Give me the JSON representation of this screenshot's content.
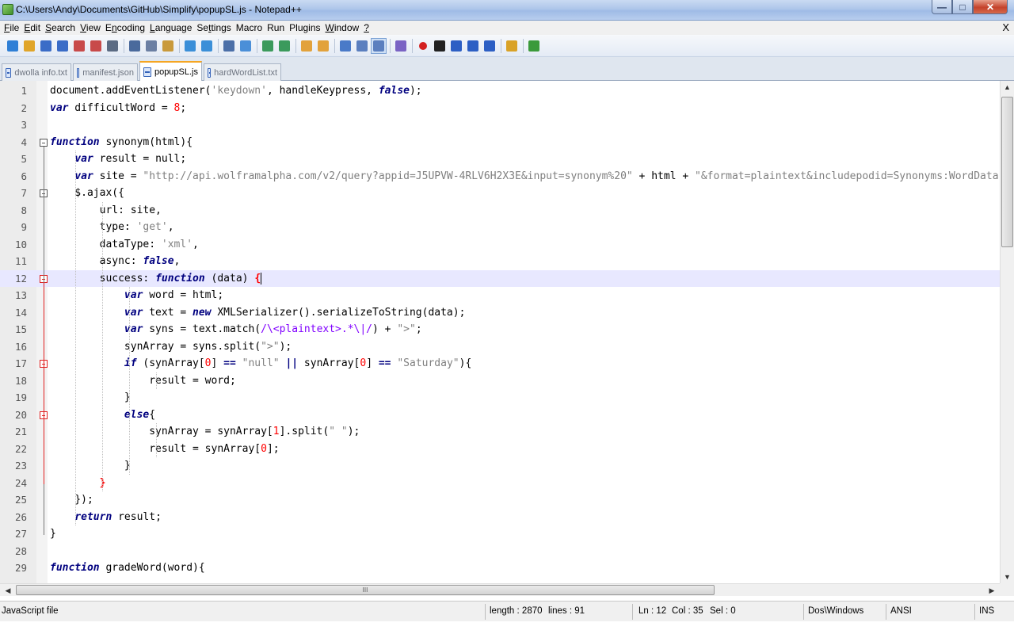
{
  "window": {
    "title": "C:\\Users\\Andy\\Documents\\GitHub\\Simplify\\popupSL.js - Notepad++"
  },
  "menu": {
    "items": [
      {
        "pre": "",
        "key": "F",
        "post": "ile"
      },
      {
        "pre": "",
        "key": "E",
        "post": "dit"
      },
      {
        "pre": "",
        "key": "S",
        "post": "earch"
      },
      {
        "pre": "",
        "key": "V",
        "post": "iew"
      },
      {
        "pre": "E",
        "key": "n",
        "post": "coding"
      },
      {
        "pre": "",
        "key": "L",
        "post": "anguage"
      },
      {
        "pre": "Se",
        "key": "t",
        "post": "tings"
      },
      {
        "pre": "Macro",
        "key": "",
        "post": ""
      },
      {
        "pre": "Run",
        "key": "",
        "post": ""
      },
      {
        "pre": "Plugins",
        "key": "",
        "post": ""
      },
      {
        "pre": "",
        "key": "W",
        "post": "indow"
      },
      {
        "pre": "",
        "key": "?",
        "post": ""
      }
    ],
    "close": "X"
  },
  "tabs": [
    {
      "label": "dwolla info.txt",
      "active": false
    },
    {
      "label": "manifest.json",
      "active": false
    },
    {
      "label": "popupSL.js",
      "active": true
    },
    {
      "label": "hardWordList.txt",
      "active": false
    }
  ],
  "editor": {
    "current_line": 12,
    "lines": [
      {
        "n": "1",
        "html": "document.addEventListener(<span class=\"str\">'keydown'</span>, handleKeypress, <span class=\"kw\">false</span>);"
      },
      {
        "n": "2",
        "html": "<span class=\"kw\">var</span> difficultWord = <span class=\"num\">8</span>;"
      },
      {
        "n": "3",
        "html": ""
      },
      {
        "n": "4",
        "html": "<span class=\"kw\">function</span> synonym(html){"
      },
      {
        "n": "5",
        "html": "    <span class=\"kw\">var</span> result = null;"
      },
      {
        "n": "6",
        "html": "    <span class=\"kw\">var</span> site = <span class=\"str\">\"http://api.wolframalpha.com/v2/query?appid=J5UPVW-4RLV6H2X3E&input=synonym%20\"</span> + html + <span class=\"str\">\"&format=plaintext&includepodid=Synonyms:WordData\"</span>;"
      },
      {
        "n": "7",
        "html": "    $.ajax({"
      },
      {
        "n": "8",
        "html": "        url: site,"
      },
      {
        "n": "9",
        "html": "        type: <span class=\"str\">'get'</span>,"
      },
      {
        "n": "10",
        "html": "        dataType: <span class=\"str\">'xml'</span>,"
      },
      {
        "n": "11",
        "html": "        async: <span class=\"kw\">false</span>,"
      },
      {
        "n": "12",
        "html": "        success: <span class=\"kw\">function</span> (data) <span class=\"brace-hl\">{</span>"
      },
      {
        "n": "13",
        "html": "            <span class=\"kw\">var</span> word = html;"
      },
      {
        "n": "14",
        "html": "            <span class=\"kw\">var</span> text = <span class=\"kw\">new</span> XMLSerializer().serializeToString(data);"
      },
      {
        "n": "15",
        "html": "            <span class=\"kw\">var</span> syns = text.match(<span class=\"rx\">/\\&lt;plaintext&gt;.*\\|/</span>) + <span class=\"str\">\"&gt;\"</span>;"
      },
      {
        "n": "16",
        "html": "            synArray = syns.split(<span class=\"str\">\"&gt;\"</span>);"
      },
      {
        "n": "17",
        "html": "            <span class=\"kw\">if</span> (synArray[<span class=\"num\">0</span>] <span class=\"op\">==</span> <span class=\"str\">\"null\"</span> <span class=\"op\">||</span> synArray[<span class=\"num\">0</span>] <span class=\"op\">==</span> <span class=\"str\">\"Saturday\"</span>){"
      },
      {
        "n": "18",
        "html": "                result = word;"
      },
      {
        "n": "19",
        "html": "            }"
      },
      {
        "n": "20",
        "html": "            <span class=\"kw\">else</span>{"
      },
      {
        "n": "21",
        "html": "                synArray = synArray[<span class=\"num\">1</span>].split(<span class=\"str\">\" \"</span>);"
      },
      {
        "n": "22",
        "html": "                result = synArray[<span class=\"num\">0</span>];"
      },
      {
        "n": "23",
        "html": "            }"
      },
      {
        "n": "24",
        "html": "        <span class=\"num\" style=\"font-weight:bold\">}</span>"
      },
      {
        "n": "25",
        "html": "    });"
      },
      {
        "n": "26",
        "html": "    <span class=\"kw\">return</span> result;"
      },
      {
        "n": "27",
        "html": "}"
      },
      {
        "n": "28",
        "html": ""
      },
      {
        "n": "29",
        "html": "<span class=\"kw\">function</span> gradeWord(word){"
      }
    ]
  },
  "statusbar": {
    "file_type": "JavaScript file",
    "length": "length : 2870",
    "lines": "lines : 91",
    "ln": "Ln : 12",
    "col": "Col : 35",
    "sel": "Sel : 0",
    "eol": "Dos\\Windows",
    "encoding": "ANSI",
    "mode": "INS"
  },
  "scroll": {
    "thumb_label": "III"
  },
  "icons": {
    "toolbar": [
      "new-file-icon",
      "open-file-icon",
      "save-icon",
      "save-all-icon",
      "close-icon",
      "close-all-icon",
      "print-icon",
      "cut-icon",
      "copy-icon",
      "paste-icon",
      "undo-icon",
      "redo-icon",
      "find-icon",
      "replace-icon",
      "zoom-in-icon",
      "zoom-out-icon",
      "sync-vertical-icon",
      "sync-horizontal-icon",
      "word-wrap-icon",
      "show-all-chars-icon",
      "indent-guide-icon",
      "user-lang-icon",
      "record-macro-icon",
      "stop-macro-icon",
      "play-macro-icon",
      "run-macro-multiple-icon",
      "save-macro-icon",
      "plugin-icon",
      "spellcheck-icon"
    ],
    "colors": [
      "#2f7fd6",
      "#e0a52a",
      "#3a6cc7",
      "#3a6cc7",
      "#c84a4a",
      "#c84a4a",
      "#5b6b83",
      "#4a6a9c",
      "#6b7fa3",
      "#c99a3c",
      "#3b8fd8",
      "#3b8fd8",
      "#4b6fa8",
      "#4b8fd8",
      "#3b9a5c",
      "#3b9a5c",
      "#e2a23c",
      "#e2a23c",
      "#4a7ac8",
      "#5b7fbf",
      "#5b7fbf",
      "#7a63c4",
      "#d32020",
      "#222222",
      "#2d5fc4",
      "#2d5fc4",
      "#2d5fc4",
      "#d9a227",
      "#3b9a3b"
    ]
  }
}
